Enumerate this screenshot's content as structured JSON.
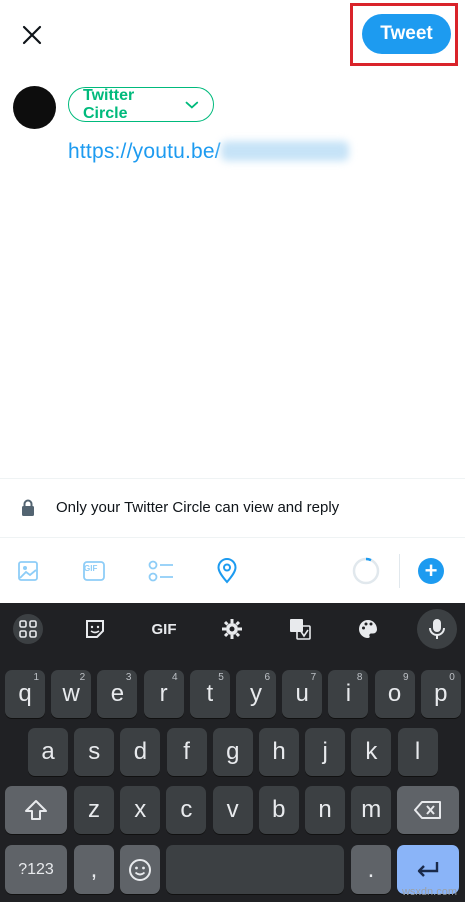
{
  "topbar": {
    "tweet_label": "Tweet"
  },
  "composer": {
    "audience_label": "Twitter Circle",
    "tweet_text": "https://youtu.be/"
  },
  "reply_setting": {
    "text": "Only your Twitter Circle can view and reply"
  },
  "toolbar": {
    "gif_label": "GIF",
    "add_label": "+"
  },
  "keyboard": {
    "toolbar_gif": "GIF",
    "row1": [
      {
        "key": "q",
        "hint": "1"
      },
      {
        "key": "w",
        "hint": "2"
      },
      {
        "key": "e",
        "hint": "3"
      },
      {
        "key": "r",
        "hint": "4"
      },
      {
        "key": "t",
        "hint": "5"
      },
      {
        "key": "y",
        "hint": "6"
      },
      {
        "key": "u",
        "hint": "7"
      },
      {
        "key": "i",
        "hint": "8"
      },
      {
        "key": "o",
        "hint": "9"
      },
      {
        "key": "p",
        "hint": "0"
      }
    ],
    "row2": [
      "a",
      "s",
      "d",
      "f",
      "g",
      "h",
      "j",
      "k",
      "l"
    ],
    "row3": [
      "z",
      "x",
      "c",
      "v",
      "b",
      "n",
      "m"
    ],
    "symbols_label": "?123",
    "comma_label": ",",
    "period_label": "."
  },
  "watermark": "wsxdn.com",
  "colors": {
    "accent": "#1d9bf0",
    "circle": "#00ba7c",
    "highlight": "#d9232a"
  }
}
